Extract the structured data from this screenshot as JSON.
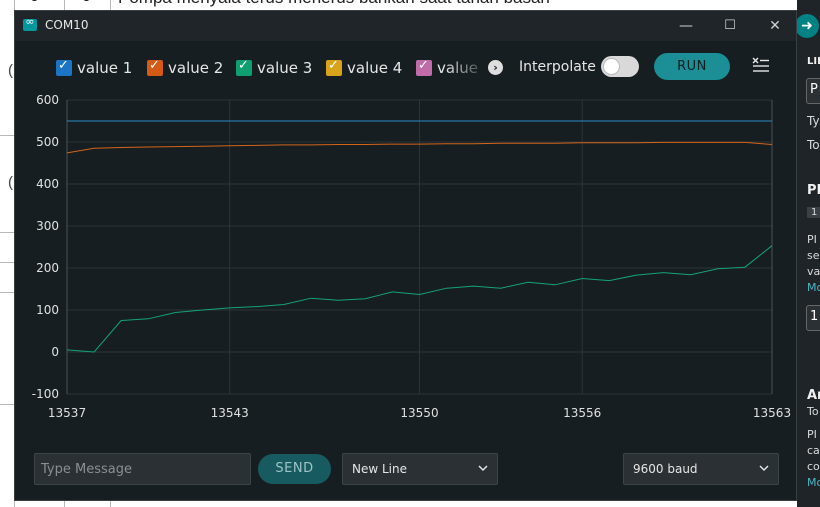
{
  "background": {
    "doc_text": "Pompa menyala terus menerus bahkan saat tanah basah",
    "doc_nums": [
      "0",
      "0"
    ],
    "parens": [
      "(",
      "("
    ],
    "ide": {
      "label_lib": "LIB",
      "box_text": "P",
      "ty": "Ty",
      "to": "To",
      "pi": "PI",
      "badge": "1",
      "pi2": "PI",
      "se": "se",
      "va": "va",
      "me": "Mo",
      "box2": "1",
      "ar": "Ar",
      "to2": "To",
      "pi3": "PI",
      "ca": "ca",
      "co": "co",
      "me2": "Mo"
    }
  },
  "window": {
    "title": "COM10",
    "minimize": "—",
    "maximize": "☐",
    "close": "✕"
  },
  "toolbar": {
    "legend": [
      {
        "label": "value 1",
        "color": "#1c74c4"
      },
      {
        "label": "value 2",
        "color": "#d35b16"
      },
      {
        "label": "value 3",
        "color": "#0f9e6f"
      },
      {
        "label": "value 4",
        "color": "#d9a21b"
      },
      {
        "label": "value",
        "color": "#c16ba9"
      }
    ],
    "more_icon": "›",
    "interpolate_label": "Interpolate",
    "interpolate_on": false,
    "run_label": "RUN",
    "clear_icon": "≡"
  },
  "chart_data": {
    "type": "line",
    "xlim": [
      13537,
      13563
    ],
    "ylim": [
      -100,
      600
    ],
    "x_ticks": [
      "13537",
      "13543",
      "13550",
      "13556",
      "13563"
    ],
    "y_ticks": [
      "600",
      "500",
      "400",
      "300",
      "200",
      "100",
      "0",
      "-100"
    ],
    "grid": true,
    "series": [
      {
        "name": "value 1",
        "color": "#2a8ac8",
        "x": [
          13537,
          13563
        ],
        "y": [
          550,
          550
        ]
      },
      {
        "name": "value 2",
        "color": "#d3641a",
        "x": [
          13537,
          13538,
          13539,
          13540,
          13541,
          13542,
          13543,
          13544,
          13545,
          13546,
          13547,
          13548,
          13549,
          13550,
          13551,
          13552,
          13553,
          13554,
          13555,
          13556,
          13557,
          13558,
          13559,
          13560,
          13561,
          13562,
          13563
        ],
        "y": [
          474,
          485,
          487,
          488,
          489,
          490,
          491,
          492,
          493,
          493,
          494,
          494,
          495,
          495,
          496,
          496,
          497,
          497,
          497,
          498,
          498,
          498,
          499,
          499,
          499,
          499,
          494
        ]
      },
      {
        "name": "value 3",
        "color": "#14a37a",
        "x": [
          13537,
          13538,
          13539,
          13540,
          13541,
          13542,
          13543,
          13544,
          13545,
          13546,
          13547,
          13548,
          13549,
          13550,
          13551,
          13552,
          13553,
          13554,
          13555,
          13556,
          13557,
          13558,
          13559,
          13560,
          13561,
          13562,
          13563
        ],
        "y": [
          5,
          0,
          75,
          79,
          94,
          100,
          105,
          108,
          113,
          128,
          123,
          127,
          143,
          137,
          152,
          157,
          152,
          166,
          160,
          175,
          170,
          183,
          189,
          184,
          198,
          202,
          253
        ]
      }
    ]
  },
  "footer": {
    "message_placeholder": "Type Message",
    "send_label": "SEND",
    "line_ending": "New Line",
    "baud": "9600 baud",
    "chevron": "⌄"
  }
}
